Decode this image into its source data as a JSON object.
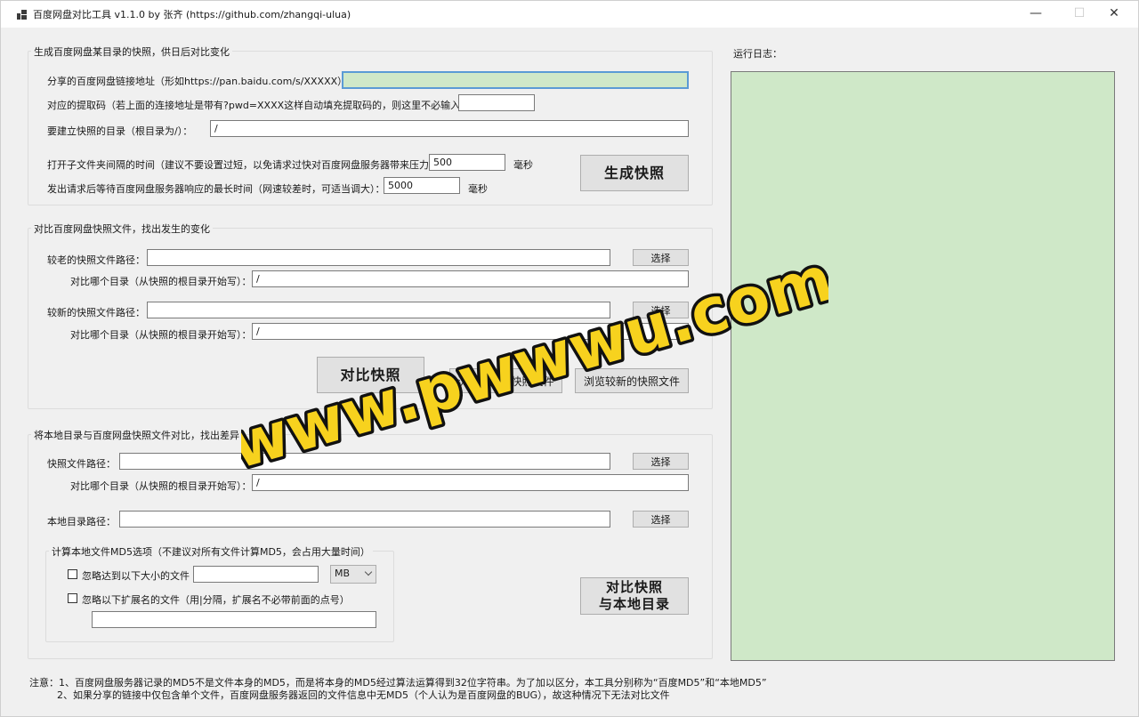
{
  "window": {
    "title": "百度网盘对比工具 v1.1.0 by 张齐  (https://github.com/zhangqi-ulua)",
    "minimize_glyph": "—",
    "maximize_glyph": "☐",
    "close_glyph": "✕"
  },
  "snapshot_group": {
    "legend": "生成百度网盘某目录的快照，供日后对比变化",
    "share_link_label": "分享的百度网盘链接地址（形如https://pan.baidu.com/s/XXXXX）：",
    "share_link_value": "",
    "extract_code_label": "对应的提取码（若上面的连接地址是带有?pwd=XXXX这样自动填充提取码的，则这里不必输入）：",
    "extract_code_value": "",
    "dir_label": "要建立快照的目录（根目录为/）：",
    "dir_value": "/",
    "interval_label": "打开子文件夹间隔的时间（建议不要设置过短，以免请求过快对百度网盘服务器带来压力）：",
    "interval_value": "500",
    "interval_unit": "毫秒",
    "timeout_label": "发出请求后等待百度网盘服务器响应的最长时间（网速较差时，可适当调大）：",
    "timeout_value": "5000",
    "timeout_unit": "毫秒",
    "generate_button": "生成快照"
  },
  "compare_group": {
    "legend": "对比百度网盘快照文件，找出发生的变化",
    "old_path_label": "较老的快照文件路径：",
    "old_path_value": "",
    "old_select": "选择",
    "old_dir_label": "对比哪个目录（从快照的根目录开始写）：",
    "old_dir_value": "/",
    "new_path_label": "较新的快照文件路径：",
    "new_path_value": "",
    "new_select": "选择",
    "new_dir_label": "对比哪个目录（从快照的根目录开始写）：",
    "new_dir_value": "/",
    "compare_button": "对比快照",
    "browse_old_button": "浏览较老的快照文件",
    "browse_new_button": "浏览较新的快照文件"
  },
  "local_group": {
    "legend": "将本地目录与百度网盘快照文件对比，找出差异",
    "snapshot_path_label": "快照文件路径：",
    "snapshot_path_value": "",
    "snapshot_select": "选择",
    "dir_label": "对比哪个目录（从快照的根目录开始写）：",
    "dir_value": "/",
    "local_dir_label": "本地目录路径：",
    "local_dir_value": "",
    "local_select": "选择",
    "md5_legend": "计算本地文件MD5选项（不建议对所有文件计算MD5，会占用大量时间）",
    "ignore_size_label": "忽略达到以下大小的文件",
    "ignore_size_value": "",
    "size_unit": "MB",
    "ignore_ext_label": "忽略以下扩展名的文件（用|分隔，扩展名不必带前面的点号）",
    "ignore_ext_value": "",
    "compare_local_button": "对比快照\n与本地目录"
  },
  "log": {
    "label": "运行日志："
  },
  "notes": {
    "line1": "注意：1、百度网盘服务器记录的MD5不是文件本身的MD5，而是将本身的MD5经过算法运算得到32位字符串。为了加以区分，本工具分别称为“百度MD5”和“本地MD5”",
    "line2": "2、如果分享的链接中仅包含单个文件，百度网盘服务器返回的文件信息中无MD5（个人认为是百度网盘的BUG），故这种情况下无法对比文件"
  },
  "watermark": {
    "text": "www.pwwwu.com",
    "fill": "#f7d21e",
    "stroke": "#111111"
  },
  "colors": {
    "input_highlight": "#cfe8c8",
    "focus_border": "#5b9bd5",
    "window_bg": "#f0f0f0"
  }
}
